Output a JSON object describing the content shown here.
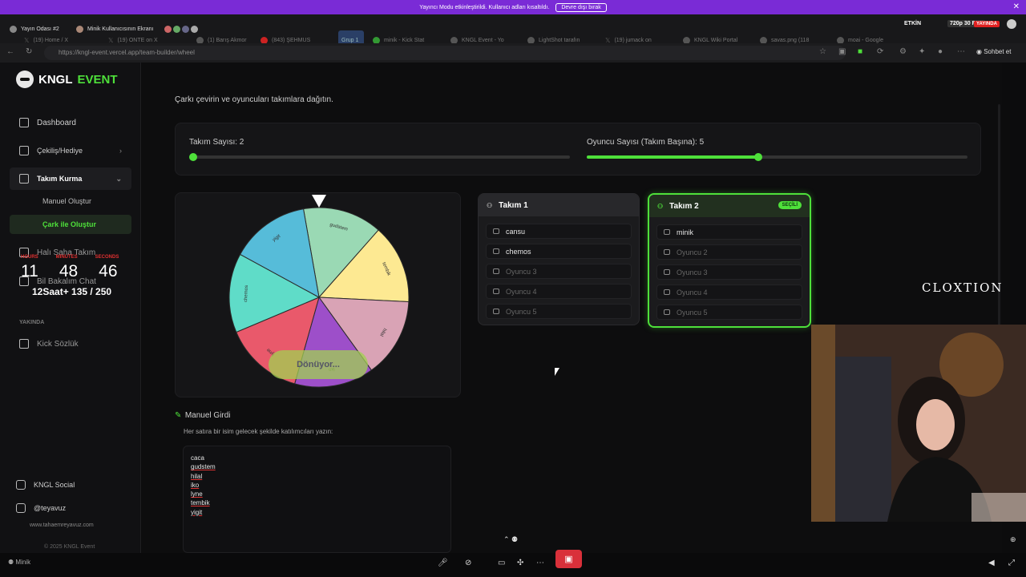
{
  "banner": {
    "message": "Yayıncı Modu etkinleştirildi. Kullanıcı adları kısaltıldı.",
    "button": "Devre dışı bırak",
    "close": "✕"
  },
  "tabs": [
    {
      "label": "Yayın Odası #2"
    },
    {
      "label": "Minik Kullanıcısının Ekranı"
    },
    {
      "label": "(19) Home / X"
    },
    {
      "label": "(19) ONTE on X"
    },
    {
      "label": "(1) Barış Akmor"
    },
    {
      "label": "(843) ŞEHMUS"
    },
    {
      "label": "Grup 1"
    },
    {
      "label": "minik - Kick Stat"
    },
    {
      "label": "KNGL Event - Yo"
    },
    {
      "label": "LightShot tarafın"
    },
    {
      "label": "(19) jumack on"
    },
    {
      "label": "KNGL Wiki Portal"
    },
    {
      "label": "savas.png (118"
    },
    {
      "label": "moai - Google"
    }
  ],
  "tabbar_status": {
    "active": "ETKİN",
    "quality": "720p 30 FPS",
    "live": "YAYINDA"
  },
  "address": {
    "url": "https://kngl-event.vercel.app/team-builder/wheel",
    "chat_button": "Sohbet et"
  },
  "app": {
    "brand_a": "KNGL",
    "brand_b": "EVENT"
  },
  "sidebar": {
    "items": [
      {
        "label": "Dashboard"
      },
      {
        "label": "Çekiliş/Hediye"
      },
      {
        "label": "Takım Kurma"
      }
    ],
    "subitems": [
      {
        "label": "Manuel Oluştur"
      },
      {
        "label": "Çark ile Oluştur"
      }
    ],
    "halisaha": "Halı Saha Takım",
    "bilbakalim": "Bil Bakalım Chat",
    "section": "YAKINDA",
    "kick": "Kick Sözlük",
    "social": "KNGL Social",
    "handle": "@teyavuz",
    "website": "www.tahaemreyavuz.com",
    "copyright": "© 2025 KNGL Event",
    "rights": "All rights reserved"
  },
  "timer": {
    "labels": [
      "HOURS",
      "MINUTES",
      "SECONDS"
    ],
    "values": [
      "11",
      "48",
      "46"
    ],
    "subtitle": "12Saat+ 135 / 250"
  },
  "main": {
    "intro": "Çarkı çevirin ve oyuncuları takımlara dağıtın.",
    "team_count_label": "Takım Sayısı: 2",
    "player_count_label": "Oyuncu Sayısı (Takım Başına): 5",
    "team_count_fraction": 0.0,
    "player_count_fraction": 0.45,
    "spin_button": "Dönüyor...",
    "manual_title": "Manuel Girdi",
    "manual_hint": "Her satıra bir isim gelecek şekilde katılımcıları yazın:",
    "names": [
      "caca",
      "gudstem",
      "hilal",
      "iko",
      "lyne",
      "tembik",
      "yigit"
    ]
  },
  "wheel": {
    "segments": [
      {
        "label": "gudstem",
        "color": "#9ad9b4"
      },
      {
        "label": "tembik",
        "color": "#fde992"
      },
      {
        "label": "hilal",
        "color": "#d9a3b5"
      },
      {
        "label": "iko",
        "color": "#9d4fc9"
      },
      {
        "label": "lyne",
        "color": "#e9596b"
      },
      {
        "label": "chemos",
        "color": "#5fdcc8"
      },
      {
        "label": "yigit",
        "color": "#56bcd9"
      }
    ]
  },
  "teams": [
    {
      "name": "Takım 1",
      "selected": false,
      "players": [
        "cansu",
        "chemos",
        "Oyuncu 3",
        "Oyuncu 4",
        "Oyuncu 5"
      ]
    },
    {
      "name": "Takım 2",
      "selected": true,
      "badge": "SEÇİLİ",
      "players": [
        "minik",
        "Oyuncu 2",
        "Oyuncu 3",
        "Oyuncu 4",
        "Oyuncu 5"
      ]
    }
  ],
  "overlay": {
    "watermark": "CLOXTION"
  },
  "bottombar": {
    "user": "Minik"
  }
}
